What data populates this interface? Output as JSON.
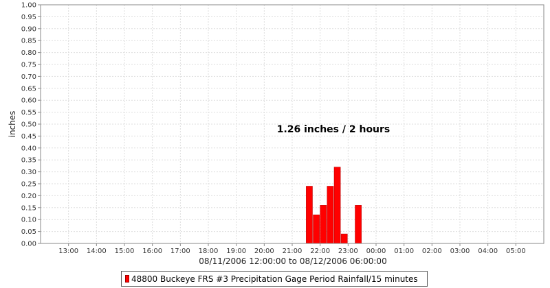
{
  "chart_data": {
    "type": "bar",
    "title": "",
    "xlabel": "08/11/2006 12:00:00 to 08/12/2006 06:00:00",
    "ylabel": "inches",
    "annotation": "1.26 inches / 2 hours",
    "x_start": "2006-08-11 12:00",
    "x_end": "2006-08-12 06:00",
    "x_tick_labels": [
      "13:00",
      "14:00",
      "15:00",
      "16:00",
      "17:00",
      "18:00",
      "19:00",
      "20:00",
      "21:00",
      "22:00",
      "23:00",
      "00:00",
      "01:00",
      "02:00",
      "03:00",
      "04:00",
      "05:00"
    ],
    "ylim": [
      0,
      1.0
    ],
    "y_tick_labels": [
      "0.00",
      "0.05",
      "0.10",
      "0.15",
      "0.20",
      "0.25",
      "0.30",
      "0.35",
      "0.40",
      "0.45",
      "0.50",
      "0.55",
      "0.60",
      "0.65",
      "0.70",
      "0.75",
      "0.80",
      "0.85",
      "0.90",
      "0.95",
      "1.00"
    ],
    "grid": true,
    "legend_position": "bottom-center",
    "bar_color": "#ff0000",
    "series": [
      {
        "name": "48800 Buckeye FRS #3 Precipitation Gage Period Rainfall/15 minutes",
        "points": [
          {
            "x": "2006-08-11 21:30",
            "value": 0.24
          },
          {
            "x": "2006-08-11 21:45",
            "value": 0.12
          },
          {
            "x": "2006-08-11 22:00",
            "value": 0.16
          },
          {
            "x": "2006-08-11 22:15",
            "value": 0.24
          },
          {
            "x": "2006-08-11 22:30",
            "value": 0.32
          },
          {
            "x": "2006-08-11 22:45",
            "value": 0.04
          },
          {
            "x": "2006-08-11 23:15",
            "value": 0.16
          }
        ]
      }
    ]
  }
}
